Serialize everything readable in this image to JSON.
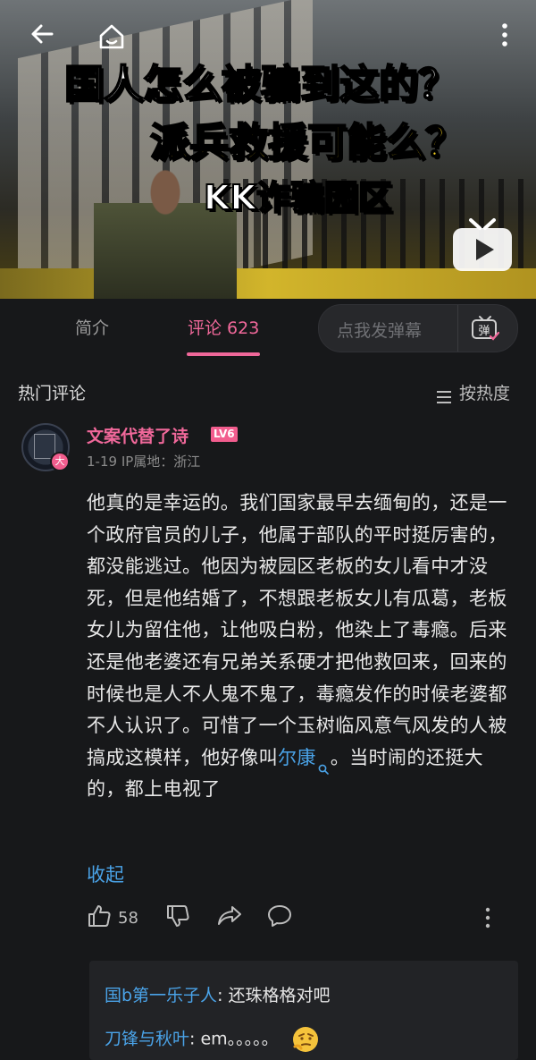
{
  "video": {
    "title_line1": "国人怎么被骗到这的？",
    "title_line2": "派兵救援可能么？",
    "title_line3": "KK诈骗园区",
    "icons": [
      "back-arrow-icon",
      "home-icon",
      "more-vertical-icon",
      "tv-play-icon"
    ]
  },
  "tabs": {
    "intro": "简介",
    "comments": "评论 623",
    "danmaku_placeholder": "点我发弹幕",
    "danmaku_icon_label": "弹"
  },
  "comments_header": {
    "title": "热门评论",
    "sort": "按热度"
  },
  "comment": {
    "username": "文案代替了诗",
    "level": "LV6",
    "vip_badge": "大",
    "date": "1-19",
    "ip": "IP属地：浙江",
    "text_before_link": "他真的是幸运的。我们国家最早去缅甸的，还是一个政府官员的儿子，他属于部队的平时挺厉害的，都没能逃过。他因为被园区老板的女儿看中才没死，但是他结婚了，不想跟老板女儿有瓜葛，老板女儿为留住他，让他吸白粉，他染上了毒瘾。后来还是他老婆还有兄弟关系硬才把他救回来，回来的时候也是人不人鬼不鬼了，毒瘾发作的时候老婆都不人认识了。可惜了一个玉树临风意气风发的人被搞成这模样，他好像叫",
    "link_text": "尔康",
    "text_after_link": "。当时闹的还挺大的，都上电视了",
    "collapse": "收起",
    "likes": "58"
  },
  "replies": [
    {
      "name": "国b第一乐子人",
      "text": ": 还珠格格对吧"
    },
    {
      "name": "刀锋与秋叶",
      "text": ": em。。。。。"
    }
  ],
  "colors": {
    "accent_pink": "#f0689a",
    "link_blue": "#4aa3e8",
    "background": "#17181a"
  }
}
